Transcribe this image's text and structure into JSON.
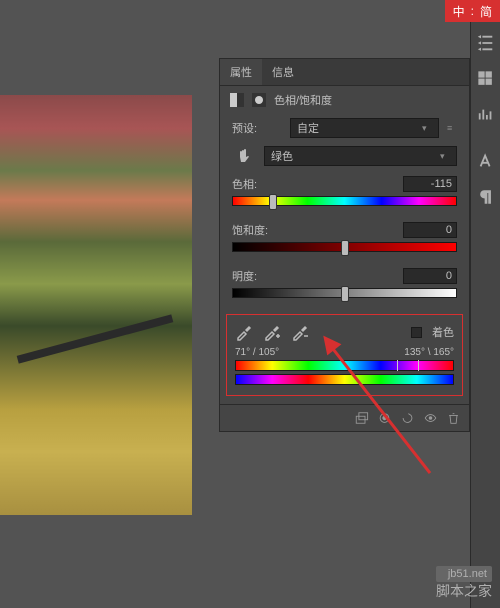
{
  "ime": {
    "lang": "中",
    "sep": ":",
    "mode": "简"
  },
  "panel": {
    "tabs": {
      "properties": "属性",
      "info": "信息"
    },
    "title": "色相/饱和度",
    "preset_label": "预设:",
    "preset_value": "自定",
    "channel_label": "绿色",
    "sliders": {
      "hue": {
        "label": "色相:",
        "value": "-115",
        "handle_pct": 18
      },
      "saturation": {
        "label": "饱和度:",
        "value": "0",
        "handle_pct": 50
      },
      "lightness": {
        "label": "明度:",
        "value": "0",
        "handle_pct": 50
      }
    },
    "color_range": {
      "colorize_label": "着色",
      "range_left": "71° / 105°",
      "range_right": "135° \\ 165°"
    }
  },
  "watermark": {
    "site": "jb51.net",
    "name": "脚本之家"
  }
}
